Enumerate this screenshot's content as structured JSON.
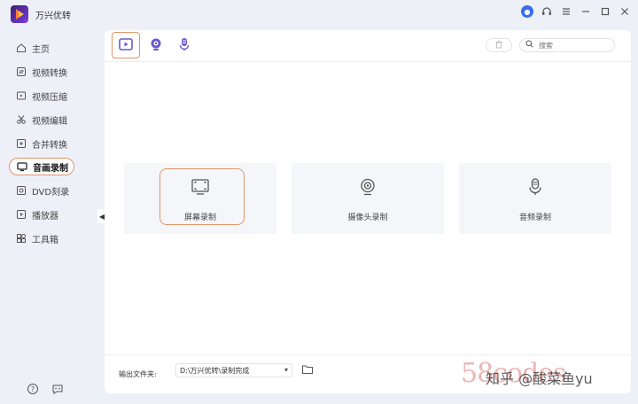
{
  "app": {
    "title": "万兴优转"
  },
  "sidebar": {
    "items": [
      {
        "label": "主页",
        "icon": "home-icon"
      },
      {
        "label": "视频转换",
        "icon": "convert-icon"
      },
      {
        "label": "视频压缩",
        "icon": "compress-icon"
      },
      {
        "label": "视频编辑",
        "icon": "scissors-icon"
      },
      {
        "label": "合并转换",
        "icon": "merge-icon"
      },
      {
        "label": "音画录制",
        "icon": "record-icon",
        "active": true
      },
      {
        "label": "DVD刻录",
        "icon": "disc-icon"
      },
      {
        "label": "播放器",
        "icon": "play-icon"
      },
      {
        "label": "工具箱",
        "icon": "toolbox-icon"
      }
    ]
  },
  "toolbar": {
    "search_placeholder": "搜索"
  },
  "cards": [
    {
      "label": "屏幕录制",
      "icon": "screen-record-icon",
      "selected": true
    },
    {
      "label": "摄像头录制",
      "icon": "webcam-icon"
    },
    {
      "label": "音频录制",
      "icon": "microphone-icon"
    }
  ],
  "footer": {
    "output_label": "输出文件夹:",
    "output_path": "D:\\万兴优转\\录制完成"
  },
  "watermark": {
    "main": "58codes",
    "overlay": "知乎 @酸菜鱼yu"
  },
  "colors": {
    "accent": "#e0956a",
    "brand": "#7b3fe4",
    "icon_purple": "#6a5acd"
  }
}
